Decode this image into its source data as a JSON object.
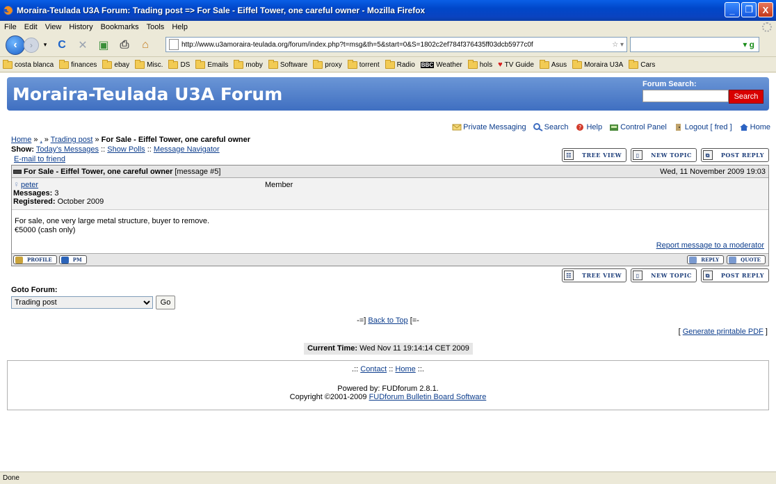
{
  "window": {
    "title": "Moraira-Teulada U3A Forum: Trading post => For Sale - Eiffel Tower, one careful owner - Mozilla Firefox",
    "controls": [
      "_",
      "❐",
      "X"
    ]
  },
  "menu": [
    "File",
    "Edit",
    "View",
    "History",
    "Bookmarks",
    "Tools",
    "Help"
  ],
  "navigation": {
    "url": "http://www.u3amoraira-teulada.org/forum/index.php?t=msg&th=5&start=0&S=1802c2ef784f376435ff03dcb5977c0f",
    "search_engine_icon": "google-icon"
  },
  "bookmarks": [
    {
      "label": "costa blanca",
      "type": "folder"
    },
    {
      "label": "finances",
      "type": "folder"
    },
    {
      "label": "ebay",
      "type": "folder"
    },
    {
      "label": "Misc.",
      "type": "folder"
    },
    {
      "label": "DS",
      "type": "folder"
    },
    {
      "label": "Emails",
      "type": "folder"
    },
    {
      "label": "moby",
      "type": "folder"
    },
    {
      "label": "Software",
      "type": "folder"
    },
    {
      "label": "proxy",
      "type": "folder"
    },
    {
      "label": "torrent",
      "type": "folder"
    },
    {
      "label": "Radio",
      "type": "folder"
    },
    {
      "label": "Weather",
      "type": "bbc"
    },
    {
      "label": "hols",
      "type": "folder"
    },
    {
      "label": "TV Guide",
      "type": "heart"
    },
    {
      "label": "Asus",
      "type": "folder"
    },
    {
      "label": "Moraira U3A",
      "type": "folder"
    },
    {
      "label": "Cars",
      "type": "folder"
    }
  ],
  "forum": {
    "title": "Moraira-Teulada U3A Forum",
    "search_label": "Forum Search:",
    "search_button": "Search"
  },
  "topnav": {
    "private_messaging": "Private Messaging",
    "search": "Search",
    "help": "Help",
    "control_panel": "Control Panel",
    "logout": "Logout [ fred ]",
    "home": "Home"
  },
  "breadcrumb": {
    "home": "Home",
    "sep1": " » ",
    "dot": ",",
    "sep2": " » ",
    "trading_post": "Trading post",
    "sep3": " » ",
    "current": "For Sale - Eiffel Tower, one careful owner"
  },
  "show": {
    "label": "Show:",
    "todays": "Today's Messages",
    "sep1": " :: ",
    "polls": "Show Polls",
    "sep2": " :: ",
    "navigator": "Message Navigator"
  },
  "email_friend": "E-mail to friend",
  "buttons": {
    "tree_view": "TREE VIEW",
    "new_topic": "NEW TOPIC",
    "post_reply": "POST REPLY"
  },
  "message": {
    "subject": "For Sale - Eiffel Tower, one careful owner",
    "number": "[message #5]",
    "date": "Wed, 11 November 2009 19:03",
    "author": "peter",
    "role": "Member",
    "messages_label": "Messages:",
    "messages_count": "3",
    "registered_label": "Registered:",
    "registered_date": "October 2009",
    "body_line1": "For sale, one very large metal structure, buyer to remove.",
    "body_line2": "€5000 (cash only)",
    "report": "Report message to a moderator",
    "profile_btn": "PROFILE",
    "pm_btn": "PM",
    "reply_btn": "REPLY",
    "quote_btn": "QUOTE"
  },
  "goto": {
    "label": "Goto Forum:",
    "selected": "Trading post",
    "go_button": "Go"
  },
  "back_to_top": {
    "prefix": "-=] ",
    "link": "Back to Top",
    "suffix": " [=-"
  },
  "pdf": {
    "prefix": "[ ",
    "link": "Generate printable PDF",
    "suffix": " ]"
  },
  "current_time": {
    "label": "Current Time:",
    "value": "Wed Nov 11 19:14:14 CET 2009"
  },
  "footer": {
    "prefix": ".:: ",
    "contact": "Contact",
    "sep": " :: ",
    "home": "Home",
    "suffix": " ::.",
    "powered": "Powered by: FUDforum 2.8.1.",
    "copyright": "Copyright ©2001-2009 ",
    "fud_link": "FUDforum Bulletin Board Software"
  },
  "status": "Done",
  "colors": {
    "titlebar": "#0a5fe6",
    "forum_header": "#4f7fcb",
    "search_button": "#d80000",
    "link": "#0b3c8c"
  }
}
